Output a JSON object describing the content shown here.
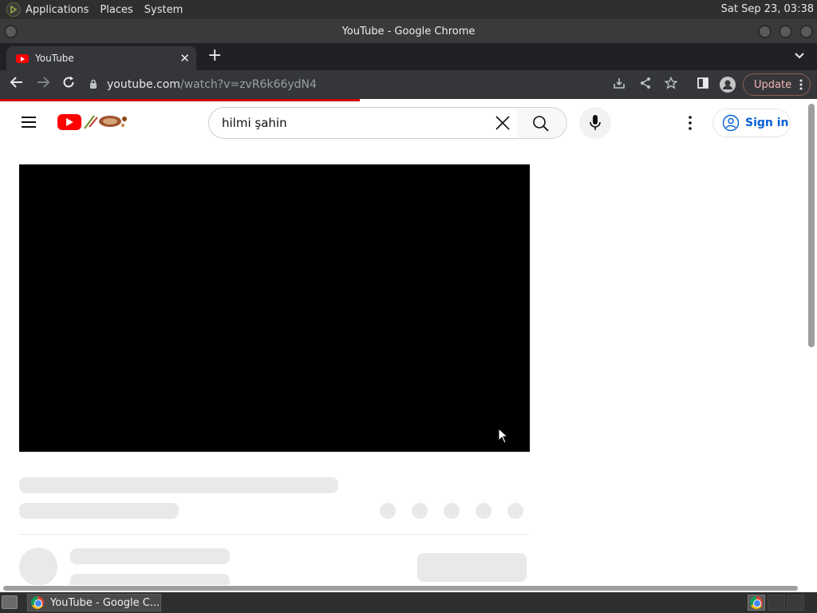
{
  "top_panel": {
    "menus": [
      "Applications",
      "Places",
      "System"
    ],
    "clock": "Sat Sep 23, 03:38"
  },
  "window": {
    "title": "YouTube - Google Chrome"
  },
  "browser": {
    "tab": {
      "title": "YouTube",
      "favicon": "youtube-favicon"
    },
    "omnibox": {
      "host": "youtube.com",
      "path": "/watch?v=zvR6k66ydN4"
    },
    "update_label": "Update",
    "load_progress": 0.44
  },
  "youtube": {
    "search_query": "hilmi şahin",
    "signin_label": "Sign in",
    "accent_color": "#ff0000",
    "link_color": "#065fd4"
  },
  "taskbar": {
    "task_label": "YouTube - Google C..."
  }
}
